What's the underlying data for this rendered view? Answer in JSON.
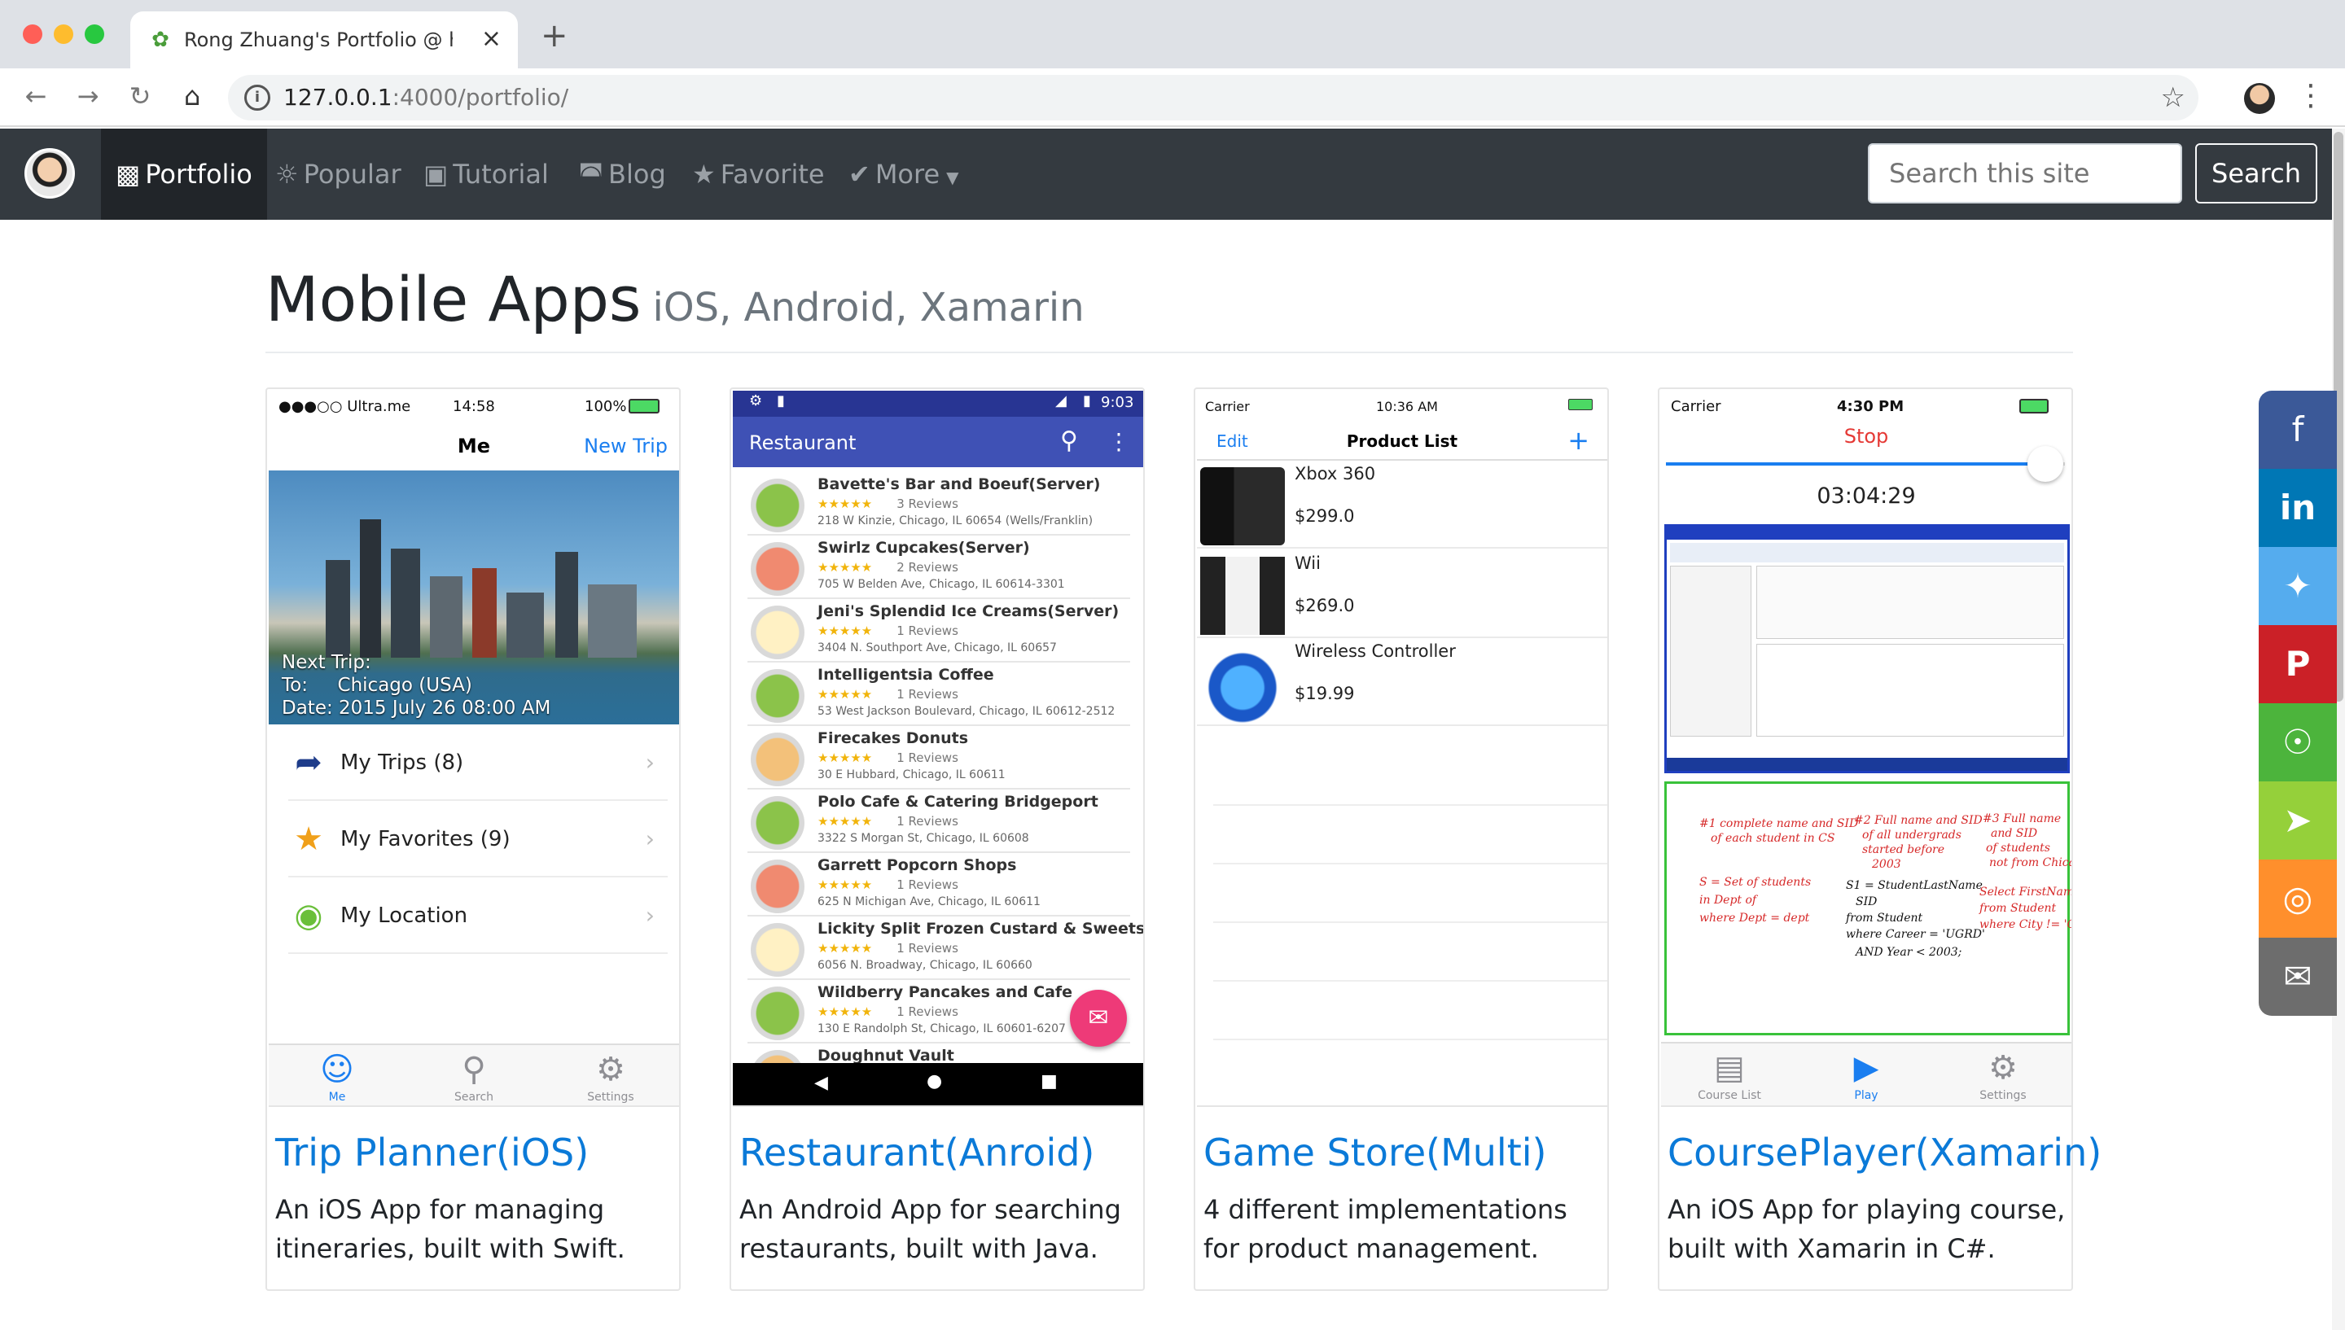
{
  "browser": {
    "tab_title": "Rong Zhuang's Portfolio @ http",
    "new_tab": "+",
    "close": "×",
    "url_host": "127.0.0.1",
    "url_rest": ":4000/portfolio/"
  },
  "nav": {
    "items": [
      {
        "label": "Portfolio",
        "icon": "briefcase-icon"
      },
      {
        "label": "Popular",
        "icon": "fire-icon"
      },
      {
        "label": "Tutorial",
        "icon": "teacher-icon"
      },
      {
        "label": "Blog",
        "icon": "rss-icon"
      },
      {
        "label": "Favorite",
        "icon": "star-icon"
      },
      {
        "label": "More",
        "icon": "check-circle-icon"
      }
    ],
    "search_placeholder": "Search this site",
    "search_button": "Search"
  },
  "page": {
    "title": "Mobile Apps",
    "subtitle": "iOS, Android, Xamarin"
  },
  "cards": [
    {
      "title": "Trip Planner(iOS)",
      "desc": "An iOS App for managing itineraries, built with Swift.",
      "screen": {
        "carrier": "●●●○○ Ultra.me",
        "time": "14:58",
        "battery": "100%",
        "nav_title": "Me",
        "nav_action": "New Trip",
        "next_trip": "Next Trip:",
        "to": "To:     Chicago (USA)",
        "date": "Date: 2015 July 26 08:00 AM",
        "rows": [
          "My Trips (8)",
          "My Favorites (9)",
          "My Location"
        ],
        "tabs": [
          "Me",
          "Search",
          "Settings"
        ]
      }
    },
    {
      "title": "Restaurant(Anroid)",
      "desc": "An Android App for searching restaurants, built with Java.",
      "screen": {
        "time": "9:03",
        "bar_title": "Restaurant",
        "items": [
          {
            "name": "Bavette's Bar and Boeuf(Server)",
            "reviews": "3 Reviews",
            "addr": "218 W Kinzie, Chicago, IL 60654 (Wells/Franklin)"
          },
          {
            "name": "Swirlz Cupcakes(Server)",
            "reviews": "2 Reviews",
            "addr": "705 W Belden Ave, Chicago, IL 60614-3301"
          },
          {
            "name": "Jeni's Splendid Ice Creams(Server)",
            "reviews": "1 Reviews",
            "addr": "3404 N. Southport Ave, Chicago, IL 60657"
          },
          {
            "name": "Intelligentsia Coffee",
            "reviews": "1 Reviews",
            "addr": "53 West Jackson Boulevard, Chicago, IL 60612-2512"
          },
          {
            "name": "Firecakes Donuts",
            "reviews": "1 Reviews",
            "addr": "30 E Hubbard, Chicago, IL 60611"
          },
          {
            "name": "Polo Cafe & Catering Bridgeport",
            "reviews": "1 Reviews",
            "addr": "3322 S Morgan St, Chicago, IL 60608"
          },
          {
            "name": "Garrett Popcorn Shops",
            "reviews": "1 Reviews",
            "addr": "625 N Michigan Ave, Chicago, IL 60611"
          },
          {
            "name": "Lickity Split Frozen Custard & Sweets",
            "reviews": "1 Reviews",
            "addr": "6056 N. Broadway, Chicago, IL 60660"
          },
          {
            "name": "Wildberry Pancakes and Cafe",
            "reviews": "1 Reviews",
            "addr": "130 E Randolph St, Chicago, IL 60601-6207"
          },
          {
            "name": "Doughnut Vault",
            "reviews": "",
            "addr": ""
          }
        ]
      }
    },
    {
      "title": "Game Store(Multi)",
      "desc": "4 different implementations for product management.",
      "screen": {
        "carrier": "Carrier",
        "time": "10:36 AM",
        "edit": "Edit",
        "nav_title": "Product List",
        "add": "+",
        "products": [
          {
            "name": "Xbox 360",
            "price": "$299.0"
          },
          {
            "name": "Wii",
            "price": "$269.0"
          },
          {
            "name": "Wireless Controller",
            "price": "$19.99"
          }
        ]
      }
    },
    {
      "title": "CoursePlayer(Xamarin)",
      "desc": "An iOS App for playing course, built with Xamarin in C#.",
      "screen": {
        "carrier": "Carrier",
        "time": "4:30 PM",
        "stop": "Stop",
        "elapsed": "03:04:29",
        "tabs": [
          "Course List",
          "Play",
          "Settings"
        ]
      }
    }
  ],
  "share": [
    {
      "name": "facebook-icon",
      "color": "#3b5998"
    },
    {
      "name": "linkedin-icon",
      "color": "#0077b5"
    },
    {
      "name": "twitter-icon",
      "color": "#55acee"
    },
    {
      "name": "pinterest-icon",
      "color": "#cb2027"
    },
    {
      "name": "wechat-icon",
      "color": "#4cb43c"
    },
    {
      "name": "share-icon",
      "color": "#95d03a"
    },
    {
      "name": "weibo-icon",
      "color": "#ff8f2c"
    },
    {
      "name": "email-icon",
      "color": "#6d6d6d"
    }
  ]
}
